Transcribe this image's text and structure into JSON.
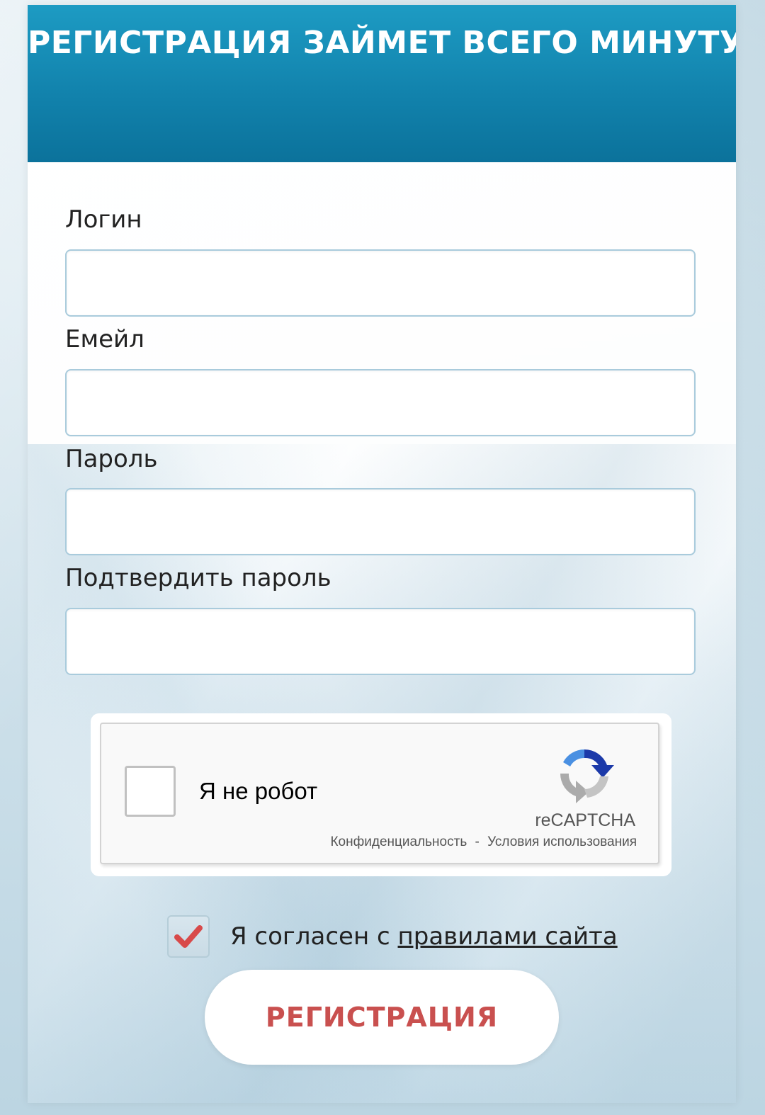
{
  "header": {
    "title": "РЕГИСТРАЦИЯ ЗАЙМЕТ ВСЕГО МИНУТУ!"
  },
  "form": {
    "login": {
      "label": "Логин",
      "value": ""
    },
    "email": {
      "label": "Емейл",
      "value": ""
    },
    "password": {
      "label": "Пароль",
      "value": ""
    },
    "confirm_password": {
      "label": "Подтвердить пароль",
      "value": ""
    }
  },
  "recaptcha": {
    "label": "Я не робот",
    "brand": "reCAPTCHA",
    "privacy_link": "Конфиденциальность",
    "separator": "-",
    "terms_link": "Условия использования",
    "checked": false,
    "icon": "recaptcha-logo-icon"
  },
  "agreement": {
    "text": "Я согласен с",
    "link": "правилами сайта",
    "checked": true,
    "check_icon": "checkmark-icon",
    "check_color": "#d84a4a"
  },
  "submit": {
    "label": "РЕГИСТРАЦИЯ"
  },
  "colors": {
    "header_top": "#1d9bc3",
    "header_bottom": "#0b729b",
    "submit_text": "#c9504f"
  }
}
